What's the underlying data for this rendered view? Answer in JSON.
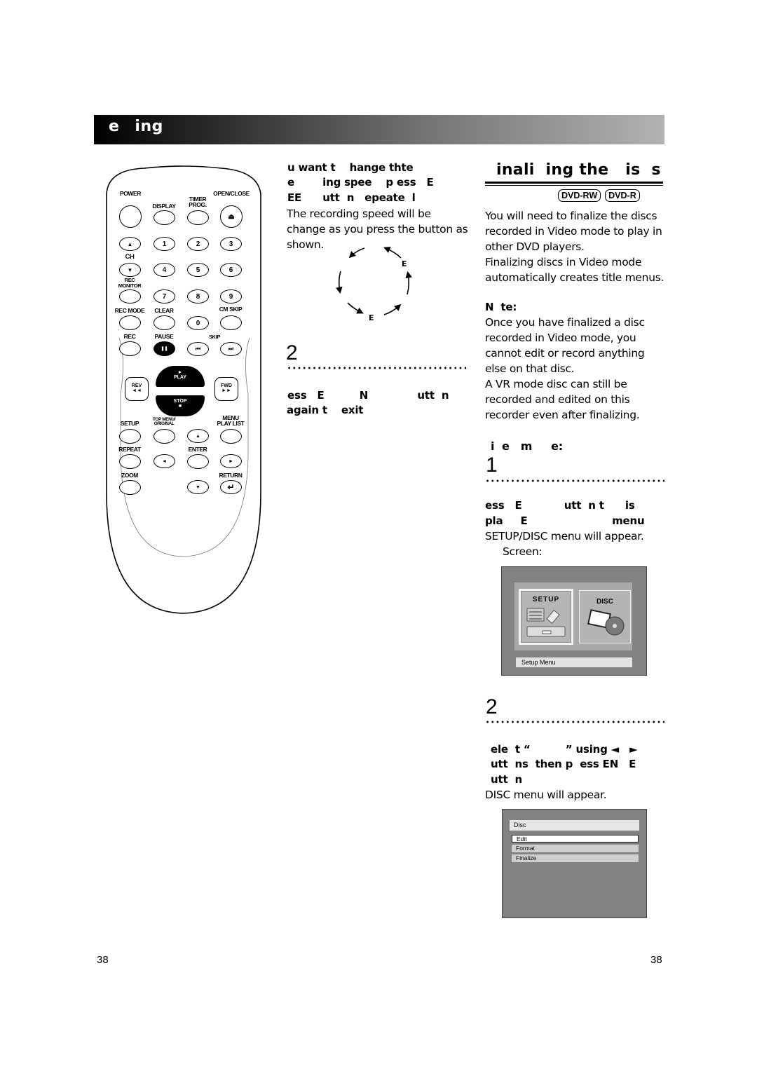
{
  "header": {
    "title_part1": "e",
    "title_part2": "ing"
  },
  "remote": {
    "labels": {
      "power": "POWER",
      "display": "DISPLAY",
      "timer_prog": "TIMER\nPROG.",
      "open_close": "OPEN/CLOSE",
      "ch": "CH",
      "rec_monitor": "REC\nMONITOR",
      "rec_mode": "REC MODE",
      "clear": "CLEAR",
      "cm_skip": "CM SKIP",
      "rec": "REC",
      "pause": "PAUSE",
      "skip": "SKIP",
      "play": "PLAY",
      "stop": "STOP",
      "rev": "REV",
      "fwd": "FWD",
      "setup": "SETUP",
      "top_menu": "TOP MENU/\nORIGINAL",
      "menu_play_list": "MENU\nPLAY LIST",
      "repeat": "REPEAT",
      "enter": "ENTER",
      "zoom": "ZOOM",
      "return": "RETURN"
    },
    "digits": [
      "1",
      "2",
      "3",
      "4",
      "5",
      "6",
      "7",
      "8",
      "9",
      "0"
    ],
    "glyphs": {
      "eject": "⏏",
      "up": "▲",
      "down": "▼",
      "left": "◄",
      "right": "►",
      "pause": "❚❚",
      "skip_back": "⏮",
      "skip_fwd": "⏭",
      "rev": "◄◄",
      "fwd": "►►",
      "play": "►",
      "stop": "■",
      "return": "↵"
    }
  },
  "middle": {
    "intro_line1": "u want t    hange thte",
    "intro_line2": "e        ing spee    p ess   E",
    "intro_line3": "EE      utt  n   epeate  l",
    "intro_body": "The recording speed will be change as you press the button as shown.",
    "cycle_labels": [
      "E",
      "E"
    ],
    "step2_number": "2",
    "step2_line1": "ess   E          N              utt  n",
    "step2_line2": "again t    exit"
  },
  "right": {
    "section_title": "inali  ing the   is  s",
    "badges": [
      "DVD-RW",
      "DVD-R"
    ],
    "intro_body": "You will need to finalize the discs recorded in Video mode to play in other DVD players.\nFinalizing discs in Video mode automatically creates title menus.",
    "note_heading": "N  te:",
    "note_body": "Once you have finalized a disc recorded in Video mode, you cannot edit or record anything else on that disc.\nA VR mode disc can still be recorded and edited on this recorder even after finalizing.",
    "subheading": "i  e   m     e:",
    "step1_number": "1",
    "step1_line1": "ess   E            utt  n t      is",
    "step1_line2": "pla     E                        menu",
    "step1_body": "SETUP/DISC menu will appear.",
    "step1_screen_label": "Screen:",
    "setup_screen": {
      "setup_tile": "SETUP",
      "disc_tile": "DISC",
      "status_bar": "Setup Menu"
    },
    "step2_number": "2",
    "step2_line1": "ele  t “          ” using ◄   ►",
    "step2_line2": "utt  ns  then p  ess EN   E",
    "step2_line3": "utt  n",
    "step2_body": "DISC menu will appear.",
    "disc_screen": {
      "title": "Disc",
      "items": [
        "Edit",
        "Format",
        "Finalize"
      ],
      "selected": "Edit"
    }
  },
  "footer": {
    "page_left": "38",
    "page_right": "38"
  }
}
